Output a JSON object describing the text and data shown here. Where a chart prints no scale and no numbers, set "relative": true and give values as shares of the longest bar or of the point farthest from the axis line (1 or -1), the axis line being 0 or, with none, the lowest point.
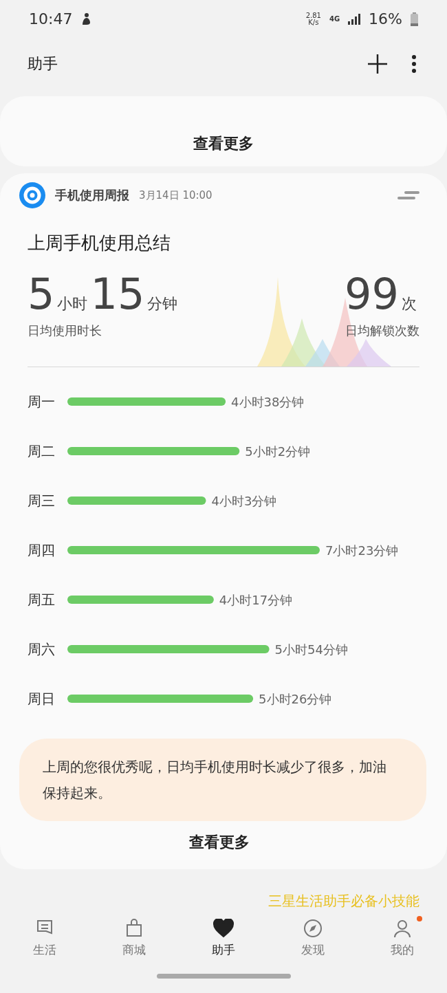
{
  "status_bar": {
    "time": "10:47",
    "speed": "2.81",
    "speed_unit": "K/s",
    "network": "4G",
    "battery": "16%"
  },
  "header": {
    "title": "助手"
  },
  "top_card": {
    "more_button": "查看更多"
  },
  "report_card": {
    "app_name": "手机使用周报",
    "date": "3月14日 10:00",
    "heading": "上周手机使用总结",
    "usage": {
      "hours": "5",
      "hours_unit": "小时",
      "minutes": "15",
      "minutes_unit": "分钟",
      "label": "日均使用时长"
    },
    "unlocks": {
      "count": "99",
      "unit": "次",
      "label": "日均解锁次数"
    },
    "chart_data": {
      "type": "bar",
      "orientation": "horizontal",
      "categories": [
        "周一",
        "周二",
        "周三",
        "周四",
        "周五",
        "周六",
        "周日"
      ],
      "values": [
        0.627,
        0.682,
        0.549,
        1,
        0.58,
        0.8,
        0.736
      ],
      "relative": true
    },
    "bar_readings": [
      "4小时38分钟",
      "5小时2分钟",
      "4小时3分钟",
      "7小时23分钟",
      "4小时17分钟",
      "5小时54分钟",
      "5小时26分钟"
    ],
    "tip": "上周的您很优秀呢，日均手机使用时长减少了很多，加油保持起来。",
    "more_button": "查看更多"
  },
  "hint": "三星生活助手必备小技能",
  "nav": [
    {
      "kind": "life",
      "label": "生活",
      "selected": false
    },
    {
      "kind": "mall",
      "label": "商城",
      "selected": false
    },
    {
      "kind": "assistant",
      "label": "助手",
      "selected": true
    },
    {
      "kind": "discover",
      "label": "发现",
      "selected": false
    },
    {
      "kind": "me",
      "label": "我的",
      "selected": false,
      "badge": true
    }
  ]
}
